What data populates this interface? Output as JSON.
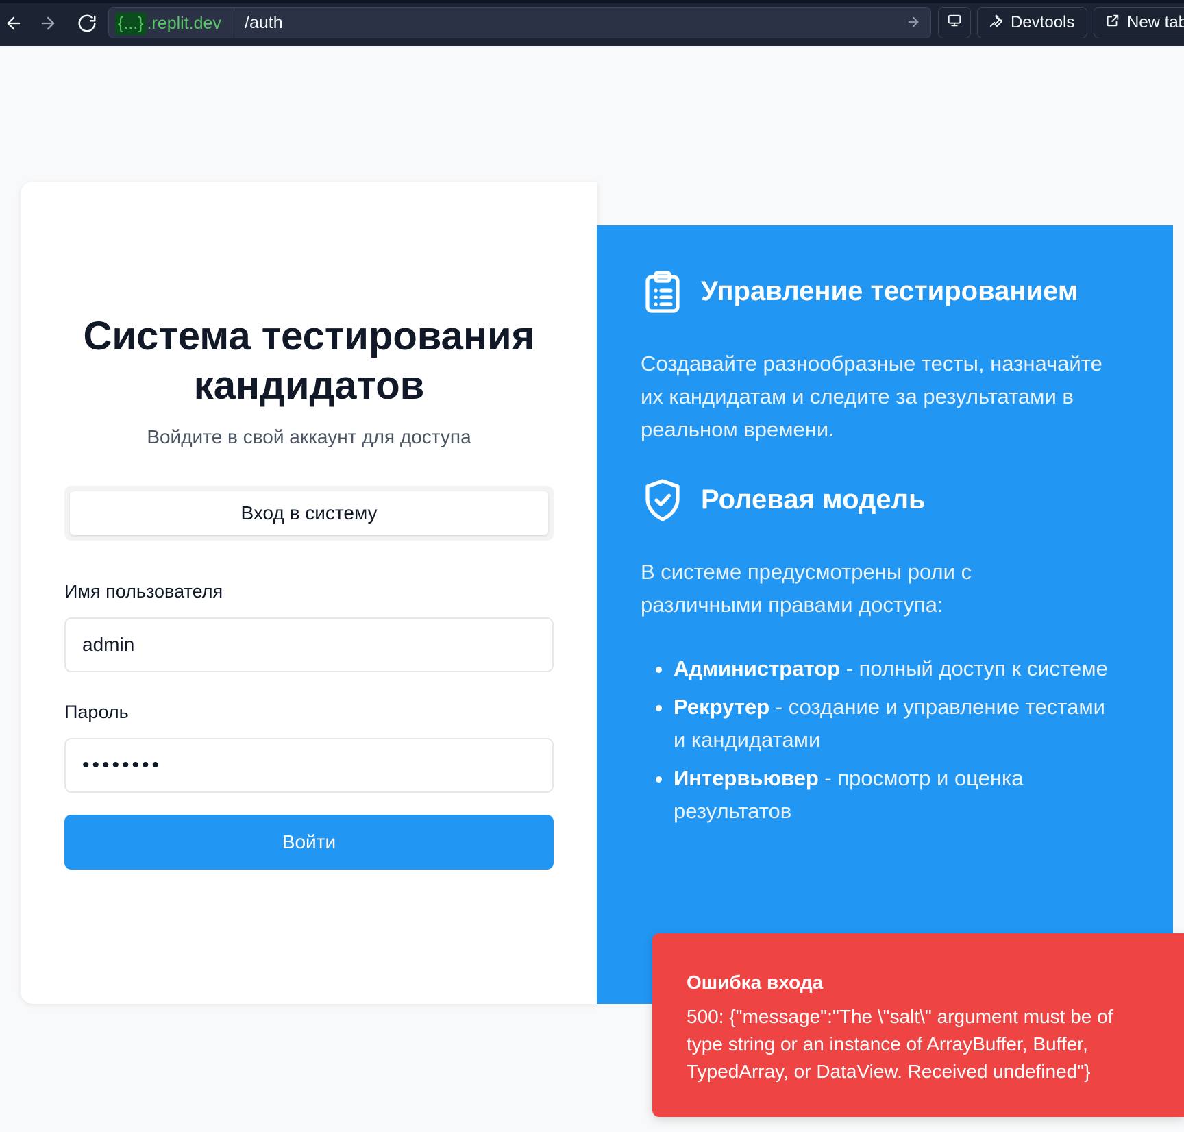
{
  "browser": {
    "url_host_prefix": "{...}",
    "url_host_suffix": ".replit.dev",
    "url_path": "/auth",
    "devtools_label": "Devtools",
    "newtab_label": "New tab"
  },
  "login": {
    "title": "Система тестирования кандидатов",
    "subtitle": "Войдите в свой аккаунт для доступа",
    "tab_label": "Вход в систему",
    "username_label": "Имя пользователя",
    "username_value": "admin",
    "password_label": "Пароль",
    "password_value": "••••••••",
    "submit_label": "Войти"
  },
  "features": {
    "testing_title": "Управление тестированием",
    "testing_text": "Создавайте разнообразные тесты, назначайте их кандидатам и следите за результатами в реальном времени.",
    "roles_title": "Ролевая модель",
    "roles_text": "В системе предусмотрены роли с различными правами доступа:",
    "roles": [
      {
        "name": "Администратор",
        "desc": " - полный доступ к системе"
      },
      {
        "name": "Рекрутер",
        "desc": " - создание и управление тестами и кандидатами"
      },
      {
        "name": "Интервьювер",
        "desc": " - просмотр и оценка результатов"
      }
    ]
  },
  "toast": {
    "title": "Ошибка входа",
    "message": "500: {\"message\":\"The \\\"salt\\\" argument must be of type string or an instance of ArrayBuffer, Buffer, TypedArray, or DataView. Received undefined\"}"
  },
  "colors": {
    "accent": "#2196f3",
    "error": "#ef4444",
    "topbar": "#1c2333"
  }
}
